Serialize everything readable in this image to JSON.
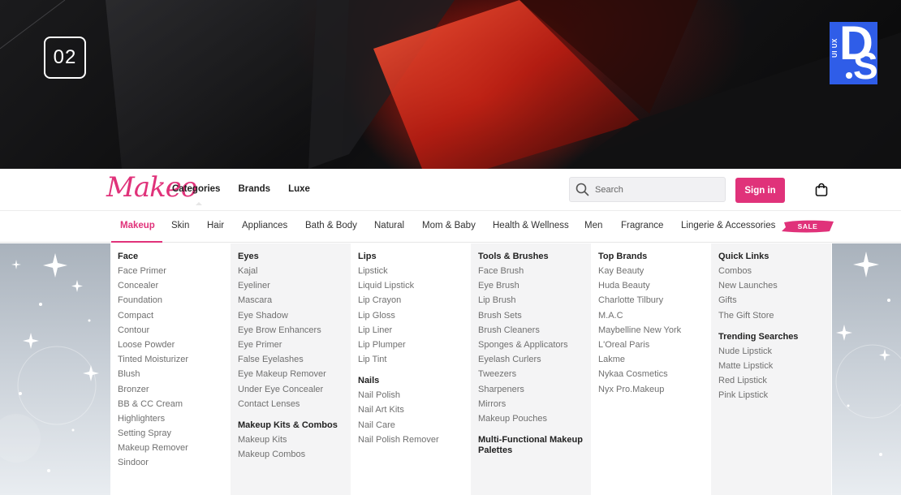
{
  "hero": {
    "slide_number": "02",
    "badge_small": "UI UX",
    "badge_d": "D",
    "badge_s": "S"
  },
  "header": {
    "logo": "Makeo",
    "nav": [
      "Categories",
      "Brands",
      "Luxe"
    ],
    "search_placeholder": "Search",
    "signin_label": "Sign in"
  },
  "categories": {
    "items": [
      "Makeup",
      "Skin",
      "Hair",
      "Appliances",
      "Bath & Body",
      "Natural",
      "Mom & Baby",
      "Health & Wellness",
      "Men",
      "Fragrance",
      "Lingerie & Accessories"
    ],
    "active": "Makeup",
    "sale_label": "SALE"
  },
  "menu": {
    "columns": [
      {
        "sections": [
          {
            "heading": "Face",
            "links": [
              "Face Primer",
              "Concealer",
              "Foundation",
              "Compact",
              "Contour",
              "Loose Powder",
              "Tinted Moisturizer",
              "Blush",
              "Bronzer",
              "BB & CC Cream",
              "Highlighters",
              "Setting Spray",
              "Makeup Remover",
              "Sindoor"
            ]
          }
        ]
      },
      {
        "sections": [
          {
            "heading": "Eyes",
            "links": [
              "Kajal",
              "Eyeliner",
              "Mascara",
              "Eye Shadow",
              "Eye Brow Enhancers",
              "Eye Primer",
              "False Eyelashes",
              "Eye Makeup Remover",
              "Under Eye Concealer",
              "Contact Lenses"
            ]
          },
          {
            "heading": "Makeup Kits & Combos",
            "links": [
              "Makeup Kits",
              "Makeup Combos"
            ]
          }
        ]
      },
      {
        "sections": [
          {
            "heading": "Lips",
            "links": [
              "Lipstick",
              "Liquid Lipstick",
              "Lip Crayon",
              "Lip Gloss",
              "Lip Liner",
              "Lip Plumper",
              "Lip Tint"
            ]
          },
          {
            "heading": "Nails",
            "links": [
              "Nail Polish",
              "Nail Art Kits",
              "Nail Care",
              "Nail Polish Remover"
            ]
          }
        ]
      },
      {
        "sections": [
          {
            "heading": "Tools & Brushes",
            "links": [
              "Face Brush",
              "Eye Brush",
              "Lip Brush",
              "Brush Sets",
              "Brush Cleaners",
              "Sponges & Applicators",
              "Eyelash Curlers",
              "Tweezers",
              "Sharpeners",
              "Mirrors",
              "Makeup Pouches"
            ]
          },
          {
            "heading": "Multi-Functional Makeup Palettes",
            "links": []
          }
        ]
      },
      {
        "sections": [
          {
            "heading": "Top Brands",
            "links": [
              "Kay Beauty",
              "Huda Beauty",
              "Charlotte Tilbury",
              "M.A.C",
              "Maybelline New York",
              "L'Oreal Paris",
              "Lakme",
              "Nykaa Cosmetics",
              "Nyx Pro.Makeup"
            ]
          }
        ]
      },
      {
        "sections": [
          {
            "heading": "Quick Links",
            "links": [
              "Combos",
              "New Launches",
              "Gifts",
              "The Gift Store"
            ]
          },
          {
            "heading": "Trending Searches",
            "links": [
              "Nude Lipstick",
              "Matte Lipstick",
              "Red Lipstick",
              "Pink Lipstick"
            ]
          }
        ]
      }
    ]
  },
  "colors": {
    "brand_pink": "#e0327a",
    "badge_blue": "#2f5de8"
  }
}
